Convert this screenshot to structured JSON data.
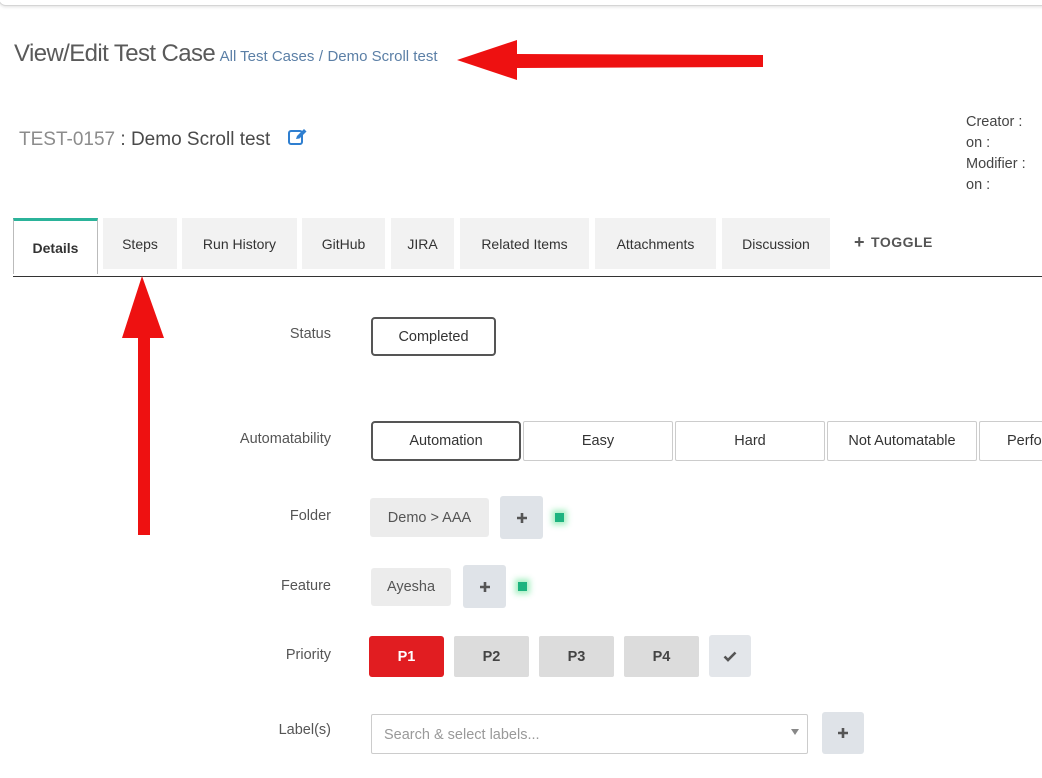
{
  "header": {
    "title": "View/Edit Test Case",
    "breadcrumb_all": "All Test Cases",
    "breadcrumb_sep": "/",
    "breadcrumb_current": "Demo Scroll test"
  },
  "test_case": {
    "id": "TEST-0157",
    "separator": " : ",
    "name": "Demo Scroll test"
  },
  "meta": {
    "creator_label": "Creator :",
    "creator_on_label": "on :",
    "modifier_label": "Modifier :",
    "modifier_on_label": "on :"
  },
  "tabs": [
    {
      "label": "Details",
      "active": true
    },
    {
      "label": "Steps"
    },
    {
      "label": "Run History"
    },
    {
      "label": "GitHub"
    },
    {
      "label": "JIRA"
    },
    {
      "label": "Related Items"
    },
    {
      "label": "Attachments"
    },
    {
      "label": "Discussion"
    }
  ],
  "toggle_label": "TOGGLE",
  "fields": {
    "status": {
      "label": "Status",
      "value": "Completed"
    },
    "automatability": {
      "label": "Automatability",
      "options": [
        "Automation",
        "Easy",
        "Hard",
        "Not Automatable",
        "Perfo"
      ],
      "selected": "Automation"
    },
    "folder": {
      "label": "Folder",
      "value": "Demo > AAA"
    },
    "feature": {
      "label": "Feature",
      "value": "Ayesha"
    },
    "priority": {
      "label": "Priority",
      "options": [
        "P1",
        "P2",
        "P3",
        "P4"
      ],
      "selected": "P1"
    },
    "labels": {
      "label": "Label(s)",
      "placeholder": "Search & select labels..."
    }
  },
  "colors": {
    "accent_tab": "#2bb39a",
    "priority_active": "#e11d21",
    "annotation_arrow": "#ee1111",
    "status_dot": "#1db37f",
    "breadcrumb_link": "#5b7fa6"
  }
}
